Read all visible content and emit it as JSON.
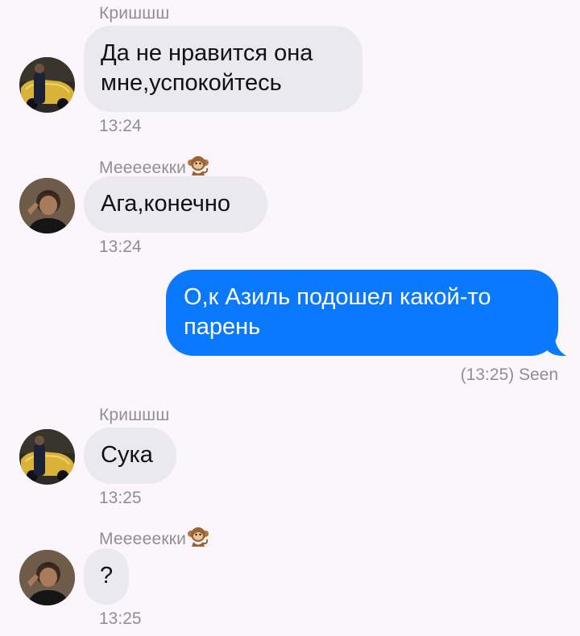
{
  "messages": [
    {
      "sender": "Кришшш",
      "text": "Да не нравится она мне,успокойтесь",
      "time": "13:24",
      "avatar_icon": "avatar-car-photo"
    },
    {
      "sender": "Мееееекки",
      "sender_emoji": "monkey-icon",
      "text": "Ага,конечно",
      "time": "13:24",
      "avatar_icon": "avatar-person-photo"
    },
    {
      "text": "О,к Азиль подошел какой-то парень",
      "status": "(13:25) Seen",
      "outgoing": true
    },
    {
      "sender": "Кришшш",
      "text": "Сука",
      "time": "13:25",
      "avatar_icon": "avatar-car-photo"
    },
    {
      "sender": "Мееееекки",
      "sender_emoji": "monkey-icon",
      "text": "?",
      "time": "13:25",
      "avatar_icon": "avatar-person-photo"
    }
  ],
  "colors": {
    "background": "#fbf6fc",
    "incoming_bubble": "#e9e9ef",
    "outgoing_bubble": "#0a79fe",
    "meta_text": "#8e8e93"
  }
}
